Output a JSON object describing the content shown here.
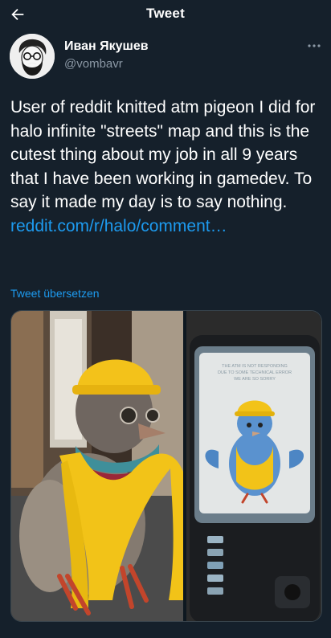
{
  "header": {
    "title": "Tweet",
    "back_icon": "arrow-left-icon"
  },
  "author": {
    "name": "Иван Якушев",
    "handle": "@vombavr"
  },
  "tweet": {
    "text": "User of reddit knitted atm pigeon I did for halo infinite \"streets\" map and this is the cutest thing about my job in all 9 years that I have been working in gamedev. To say it made my day is to say nothing.",
    "link": "reddit.com/r/halo/comment…",
    "translate_label": "Tweet übersetzen"
  },
  "media": {
    "atm_screen_text": [
      "THE ATM IS NOT RESPONDING",
      "DUE TO SOME TECHNICAL ERROR",
      "WE ARE SO SORRY"
    ]
  },
  "colors": {
    "background": "#15202b",
    "accent": "#1d9bf0",
    "muted": "#8b98a5"
  }
}
